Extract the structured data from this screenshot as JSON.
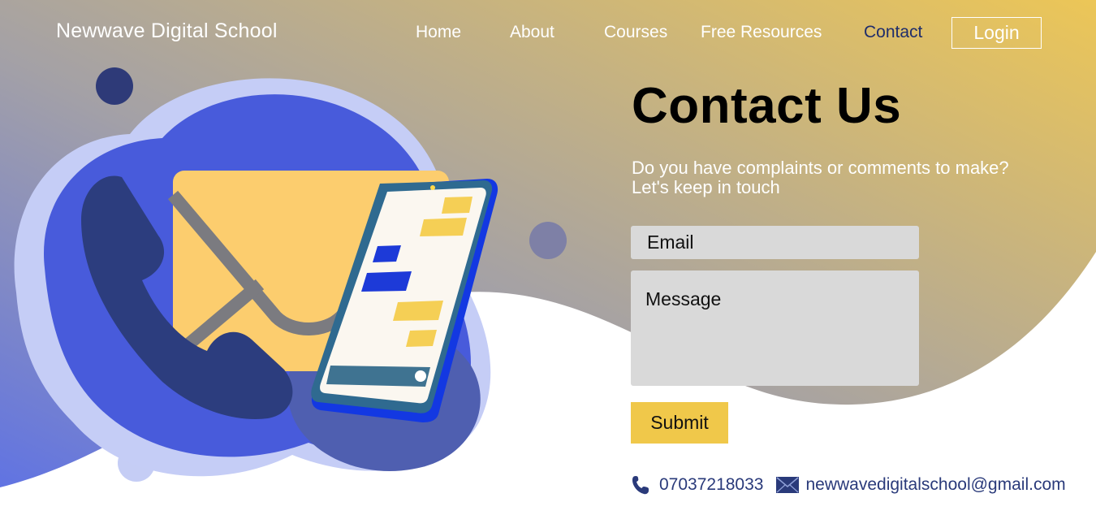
{
  "brand": "Newwave Digital School",
  "nav": {
    "links": [
      {
        "label": "Home"
      },
      {
        "label": "About"
      },
      {
        "label": "Courses"
      },
      {
        "label": "Free Resources"
      },
      {
        "label": "Contact"
      }
    ],
    "login_label": "Login"
  },
  "hero": {
    "title": "Contact Us",
    "subtitle_line1": "Do you have complaints or comments to make?",
    "subtitle_line2": "Let's keep in touch"
  },
  "form": {
    "email_placeholder": "Email",
    "message_placeholder": "Message",
    "submit_label": "Submit"
  },
  "contact": {
    "phone": "07037218033",
    "email": "newwavedigitalschool@gmail.com"
  },
  "colors": {
    "gradient_start": "#6470e0",
    "gradient_mid": "#a8a2a0",
    "gradient_end": "#e8c55c",
    "accent_navy": "#2b3a7a",
    "submit_yellow": "#f0c84a",
    "field_gray": "#d9d9d9"
  },
  "icons": [
    "phone-icon",
    "envelope-icon",
    "phone-illustration",
    "envelope-illustration",
    "smartphone-illustration"
  ]
}
